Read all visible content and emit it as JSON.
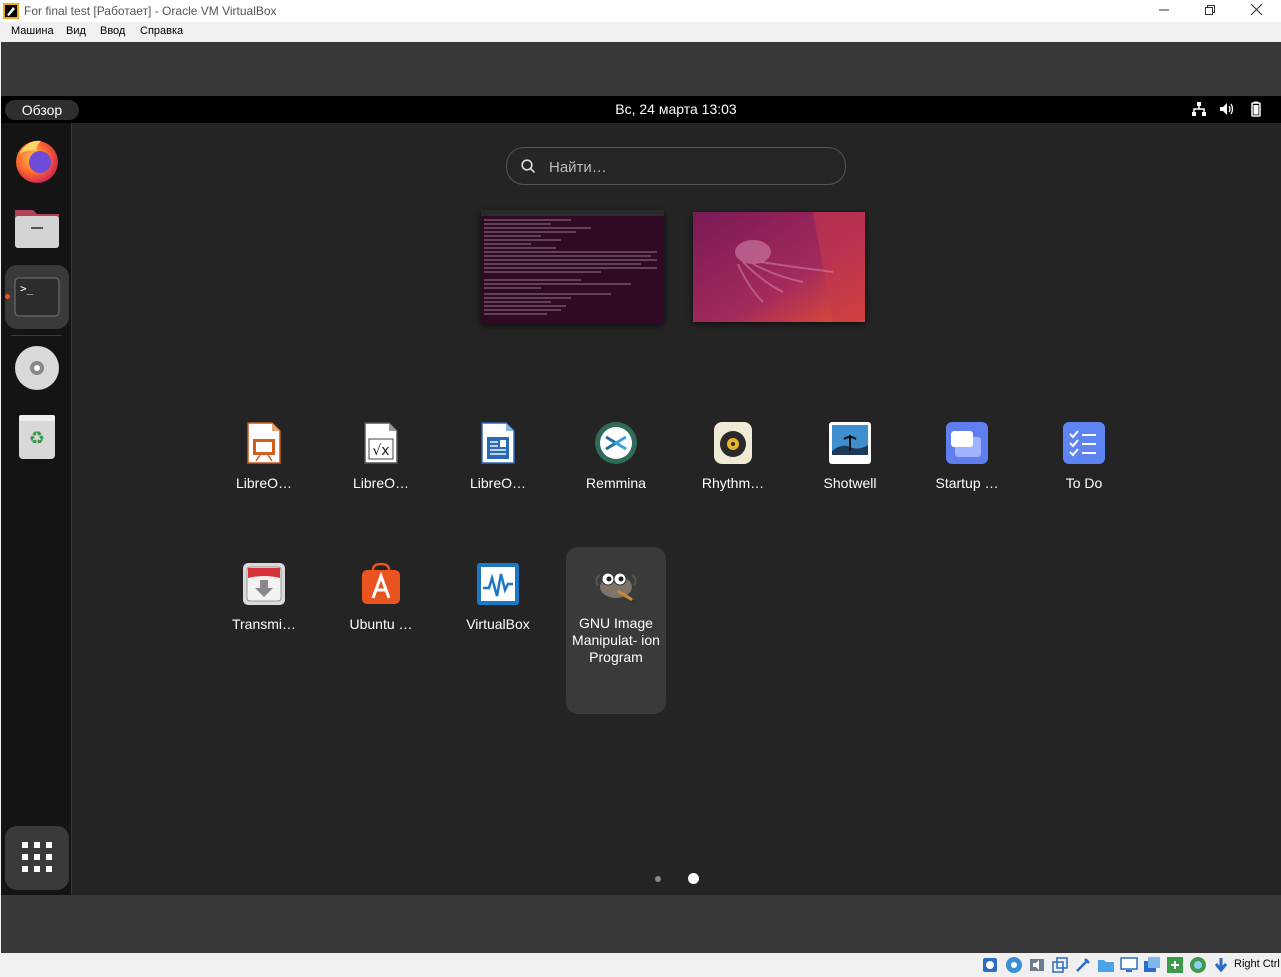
{
  "window": {
    "title": "For final test [Работает] - Oracle VM VirtualBox",
    "controls": {
      "minimize": "—",
      "restore": "❐",
      "close": "✕"
    }
  },
  "menubar": {
    "items": [
      "Машина",
      "Вид",
      "Ввод",
      "Справка"
    ]
  },
  "topbar": {
    "overview_label": "Обзор",
    "clock": "Вс, 24 марта  13:03",
    "tray_icons": [
      "network-icon",
      "volume-icon",
      "battery-icon"
    ]
  },
  "search": {
    "placeholder": "Найти…",
    "value": ""
  },
  "dock": {
    "items": [
      {
        "name": "firefox-icon"
      },
      {
        "name": "files-icon"
      },
      {
        "name": "terminal-icon",
        "running": true
      },
      {
        "name": "dvd-icon"
      },
      {
        "name": "trash-icon"
      },
      {
        "name": "app-grid-icon"
      }
    ]
  },
  "workspaces": [
    "workspace-1",
    "workspace-2"
  ],
  "apps": {
    "row1": [
      {
        "label": "LibreO…",
        "icon": "libreoffice-impress-icon"
      },
      {
        "label": "LibreO…",
        "icon": "libreoffice-math-icon"
      },
      {
        "label": "LibreO…",
        "icon": "libreoffice-writer-icon"
      },
      {
        "label": "Remmina",
        "icon": "remmina-icon"
      },
      {
        "label": "Rhythm…",
        "icon": "rhythmbox-icon"
      },
      {
        "label": "Shotwell",
        "icon": "shotwell-icon"
      },
      {
        "label": "Startup …",
        "icon": "startup-disk-icon"
      },
      {
        "label": "To Do",
        "icon": "todo-icon"
      }
    ],
    "row2": [
      {
        "label": "Transmi…",
        "icon": "transmission-icon"
      },
      {
        "label": "Ubuntu …",
        "icon": "ubuntu-software-icon"
      },
      {
        "label": "VirtualBox",
        "icon": "virtualbox-icon"
      },
      {
        "label": "GNU Image Manipulat- ion Program",
        "icon": "gimp-icon"
      }
    ]
  },
  "pager": {
    "pages": 2,
    "current": 2
  },
  "statusbar": {
    "host_key": "Right Ctrl",
    "icons": [
      "hdd-icon",
      "optical-icon",
      "audio-icon",
      "network-icon",
      "usb-icon",
      "shared-folder-icon",
      "display-icon",
      "recording-icon",
      "drag-drop-icon",
      "cpu-icon",
      "mouse-integration-icon",
      "keyboard-icon"
    ]
  }
}
